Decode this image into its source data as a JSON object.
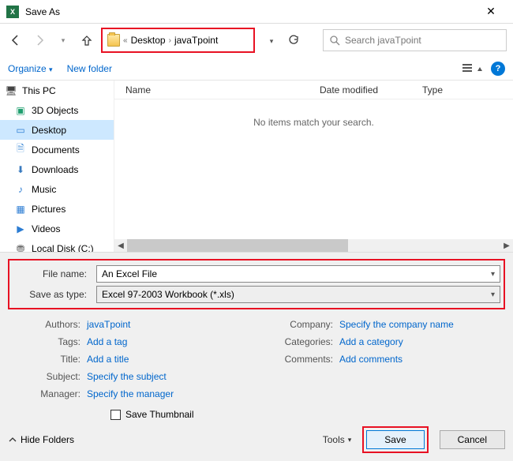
{
  "window": {
    "title": "Save As"
  },
  "breadcrumb": {
    "sep": "«",
    "parts": [
      "Desktop",
      "javaTpoint"
    ]
  },
  "search": {
    "placeholder": "Search javaTpoint"
  },
  "toolbar": {
    "organize": "Organize",
    "new_folder": "New folder"
  },
  "columns": {
    "name": "Name",
    "date": "Date modified",
    "type": "Type"
  },
  "empty_msg": "No items match your search.",
  "sidebar": {
    "items": [
      {
        "label": "This PC"
      },
      {
        "label": "3D Objects"
      },
      {
        "label": "Desktop"
      },
      {
        "label": "Documents"
      },
      {
        "label": "Downloads"
      },
      {
        "label": "Music"
      },
      {
        "label": "Pictures"
      },
      {
        "label": "Videos"
      },
      {
        "label": "Local Disk (C:)"
      }
    ]
  },
  "fields": {
    "filename_label": "File name:",
    "filename_value": "An Excel File",
    "type_label": "Save as type:",
    "type_value": "Excel 97-2003 Workbook (*.xls)"
  },
  "meta": {
    "authors_label": "Authors:",
    "authors_value": "javaTpoint",
    "tags_label": "Tags:",
    "tags_value": "Add a tag",
    "title_label": "Title:",
    "title_value": "Add a title",
    "subject_label": "Subject:",
    "subject_value": "Specify the subject",
    "manager_label": "Manager:",
    "manager_value": "Specify the manager",
    "company_label": "Company:",
    "company_value": "Specify the company name",
    "categories_label": "Categories:",
    "categories_value": "Add a category",
    "comments_label": "Comments:",
    "comments_value": "Add comments"
  },
  "thumb": {
    "label": "Save Thumbnail"
  },
  "footer": {
    "hide": "Hide Folders",
    "tools": "Tools",
    "save": "Save",
    "cancel": "Cancel"
  }
}
